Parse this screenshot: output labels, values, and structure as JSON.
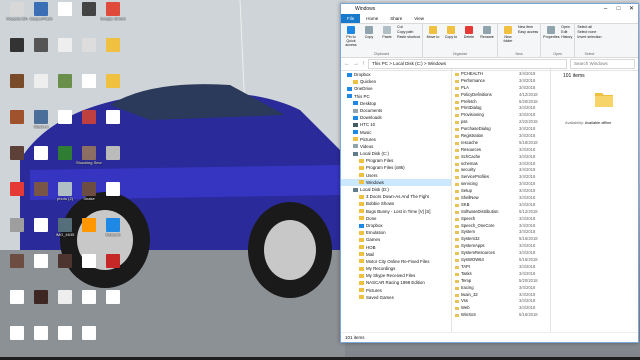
{
  "desktop_icons": [
    {
      "label": "Recycle Bin",
      "color": "#d8d8d8"
    },
    {
      "label": "CasperFlash",
      "color": "#3a6fb5"
    },
    {
      "label": "",
      "color": "#ffffff"
    },
    {
      "label": "",
      "color": "#444"
    },
    {
      "label": "Google Chrome",
      "color": "#e04a3a"
    },
    {
      "label": "",
      "color": "#333"
    },
    {
      "label": "",
      "color": "#555"
    },
    {
      "label": "",
      "color": "#eee"
    },
    {
      "label": "",
      "color": "#ddd"
    },
    {
      "label": "",
      "color": "#f0c040"
    },
    {
      "label": "",
      "color": "#7a4b2a"
    },
    {
      "label": "",
      "color": "#eee"
    },
    {
      "label": "",
      "color": "#6a8f4a"
    },
    {
      "label": "",
      "color": "#fff"
    },
    {
      "label": "",
      "color": "#f0c040"
    },
    {
      "label": "",
      "color": "#a0522d"
    },
    {
      "label": "Stacked",
      "color": "#4a6d9a"
    },
    {
      "label": "",
      "color": "#fff"
    },
    {
      "label": "",
      "color": "#c04040"
    },
    {
      "label": "",
      "color": "#fff"
    },
    {
      "label": "",
      "color": "#5d4037"
    },
    {
      "label": "",
      "color": "#fff"
    },
    {
      "label": "",
      "color": "#2e7d32"
    },
    {
      "label": "Shocking Secret Cases",
      "color": "#8d6e63"
    },
    {
      "label": "",
      "color": "#bbb"
    },
    {
      "label": "",
      "color": "#e53935"
    },
    {
      "label": "",
      "color": "#795548"
    },
    {
      "label": "photo (2)",
      "color": "#b0bec5"
    },
    {
      "label": "Snake",
      "color": "#6d4c41"
    },
    {
      "label": "",
      "color": "#fff"
    },
    {
      "label": "",
      "color": "#9e9e9e"
    },
    {
      "label": "",
      "color": "#fff"
    },
    {
      "label": "IMG_4635",
      "color": "#546e7a"
    },
    {
      "label": "",
      "color": "#ff9800"
    },
    {
      "label": "Network",
      "color": "#1e88e5"
    },
    {
      "label": "",
      "color": "#6d4c41"
    },
    {
      "label": "",
      "color": "#fff"
    },
    {
      "label": "",
      "color": "#4e342e"
    },
    {
      "label": "",
      "color": "#fff"
    },
    {
      "label": "",
      "color": "#c62828"
    },
    {
      "label": "",
      "color": "#fff"
    },
    {
      "label": "",
      "color": "#3e2723"
    },
    {
      "label": "",
      "color": "#eee"
    },
    {
      "label": "",
      "color": "#fff"
    },
    {
      "label": "",
      "color": "#fff"
    },
    {
      "label": "",
      "color": "#fff"
    },
    {
      "label": "",
      "color": "#fff"
    },
    {
      "label": "",
      "color": "#fff"
    },
    {
      "label": "",
      "color": "#fff"
    }
  ],
  "explorer": {
    "title": "Windows",
    "tabs": [
      "File",
      "Home",
      "Share",
      "View"
    ],
    "ribbon": {
      "clipboard": {
        "pin": "Pin to Quick access",
        "copy": "Copy",
        "paste": "Paste",
        "cut": "Cut",
        "copy_path": "Copy path",
        "paste_shortcut": "Paste shortcut",
        "name": "Clipboard"
      },
      "organize": {
        "move": "Move to",
        "copy": "Copy to",
        "delete": "Delete",
        "rename": "Rename",
        "name": "Organize"
      },
      "new": {
        "folder": "New folder",
        "item": "New item",
        "easy": "Easy access",
        "name": "New"
      },
      "open": {
        "properties": "Properties",
        "open": "Open",
        "edit": "Edit",
        "history": "History",
        "name": "Open"
      },
      "select": {
        "all": "Select all",
        "none": "Select none",
        "invert": "Invert selection",
        "name": "Select"
      }
    },
    "address": "This PC  >  Local Disk (C:)  >  Windows",
    "search_placeholder": "Search Windows",
    "nav_items": [
      {
        "label": "Dropbox",
        "icon": "#1e88e5",
        "indent": 0
      },
      {
        "label": "Quicken",
        "icon": "#f0c040",
        "indent": 1
      },
      {
        "label": "OneDrive",
        "icon": "#1e88e5",
        "indent": 0
      },
      {
        "label": "This PC",
        "icon": "#1e88e5",
        "indent": 0
      },
      {
        "label": "Desktop",
        "icon": "#1e88e5",
        "indent": 1
      },
      {
        "label": "Documents",
        "icon": "#90a4ae",
        "indent": 1
      },
      {
        "label": "Downloads",
        "icon": "#1e88e5",
        "indent": 1
      },
      {
        "label": "HTC 10",
        "icon": "#455a64",
        "indent": 1
      },
      {
        "label": "Music",
        "icon": "#1e88e5",
        "indent": 1
      },
      {
        "label": "Pictures",
        "icon": "#f0c040",
        "indent": 1
      },
      {
        "label": "Videos",
        "icon": "#90a4ae",
        "indent": 1
      },
      {
        "label": "Local Disk (C:)",
        "icon": "#607d8b",
        "indent": 1
      },
      {
        "label": "Program Files",
        "icon": "#f0c040",
        "indent": 2
      },
      {
        "label": "Program Files (x86)",
        "icon": "#f0c040",
        "indent": 2
      },
      {
        "label": "Users",
        "icon": "#f0c040",
        "indent": 2
      },
      {
        "label": "Windows",
        "icon": "#f0c040",
        "indent": 2,
        "selected": true
      },
      {
        "label": "Local Disk (D:)",
        "icon": "#607d8b",
        "indent": 1
      },
      {
        "label": "3 Doors Down-As And The Fight",
        "icon": "#f0c040",
        "indent": 2
      },
      {
        "label": "Bobbie Shows",
        "icon": "#f0c040",
        "indent": 2
      },
      {
        "label": "Bugs Bunny - Lost in Time [V] [S]",
        "icon": "#f0c040",
        "indent": 2
      },
      {
        "label": "Done",
        "icon": "#f0c040",
        "indent": 2
      },
      {
        "label": "Dropbox",
        "icon": "#1e88e5",
        "indent": 2
      },
      {
        "label": "Emulation",
        "icon": "#f0c040",
        "indent": 2
      },
      {
        "label": "Games",
        "icon": "#f0c040",
        "indent": 2
      },
      {
        "label": "HOB",
        "icon": "#f0c040",
        "indent": 2
      },
      {
        "label": "Mail",
        "icon": "#f0c040",
        "indent": 2
      },
      {
        "label": "Motor City Online Re-Fixed Files",
        "icon": "#f0c040",
        "indent": 2
      },
      {
        "label": "My Recordings",
        "icon": "#f0c040",
        "indent": 2
      },
      {
        "label": "My Skype Received Files",
        "icon": "#f0c040",
        "indent": 2
      },
      {
        "label": "NASCAR Racing 1999 Edition",
        "icon": "#f0c040",
        "indent": 2
      },
      {
        "label": "Pictures",
        "icon": "#f0c040",
        "indent": 2
      },
      {
        "label": "Saved Games",
        "icon": "#f0c040",
        "indent": 2
      }
    ],
    "files": [
      {
        "name": "PCHEALTH",
        "date": "3/4/2018"
      },
      {
        "name": "Performance",
        "date": "3/4/2018"
      },
      {
        "name": "PLA",
        "date": "3/4/2018"
      },
      {
        "name": "PolicyDefinitions",
        "date": "4/12/2018"
      },
      {
        "name": "Prefetch",
        "date": "5/20/2018"
      },
      {
        "name": "PrintDialog",
        "date": "3/4/2018"
      },
      {
        "name": "Provisioning",
        "date": "3/4/2018"
      },
      {
        "name": "pss",
        "date": "2/22/2018"
      },
      {
        "name": "PurchaseDialog",
        "date": "3/4/2018"
      },
      {
        "name": "Registration",
        "date": "3/4/2018"
      },
      {
        "name": "rescache",
        "date": "5/18/2018"
      },
      {
        "name": "Resources",
        "date": "3/4/2018"
      },
      {
        "name": "SchCache",
        "date": "3/4/2018"
      },
      {
        "name": "schemas",
        "date": "3/4/2018"
      },
      {
        "name": "security",
        "date": "3/4/2018"
      },
      {
        "name": "ServiceProfiles",
        "date": "3/4/2018"
      },
      {
        "name": "servicing",
        "date": "3/4/2018"
      },
      {
        "name": "Setup",
        "date": "3/4/2018"
      },
      {
        "name": "ShellNew",
        "date": "3/4/2018"
      },
      {
        "name": "SKB",
        "date": "3/4/2018"
      },
      {
        "name": "SoftwareDistribution",
        "date": "5/12/2018"
      },
      {
        "name": "Speech",
        "date": "3/4/2018"
      },
      {
        "name": "Speech_OneCore",
        "date": "3/4/2018"
      },
      {
        "name": "System",
        "date": "3/4/2018"
      },
      {
        "name": "System32",
        "date": "5/16/2018"
      },
      {
        "name": "SystemApps",
        "date": "3/4/2018"
      },
      {
        "name": "SystemResources",
        "date": "3/4/2018"
      },
      {
        "name": "SysWOW64",
        "date": "5/16/2018"
      },
      {
        "name": "TAPI",
        "date": "3/4/2018"
      },
      {
        "name": "Tasks",
        "date": "3/4/2018"
      },
      {
        "name": "Temp",
        "date": "5/20/2018"
      },
      {
        "name": "tracing",
        "date": "3/4/2018"
      },
      {
        "name": "twain_32",
        "date": "3/4/2018"
      },
      {
        "name": "Vss",
        "date": "3/4/2018"
      },
      {
        "name": "Web",
        "date": "3/4/2018"
      },
      {
        "name": "WinSxS",
        "date": "5/16/2018"
      }
    ],
    "preview": {
      "count": "101 items",
      "label": "Availability:",
      "value": "Available offline"
    },
    "status": "101 items"
  }
}
